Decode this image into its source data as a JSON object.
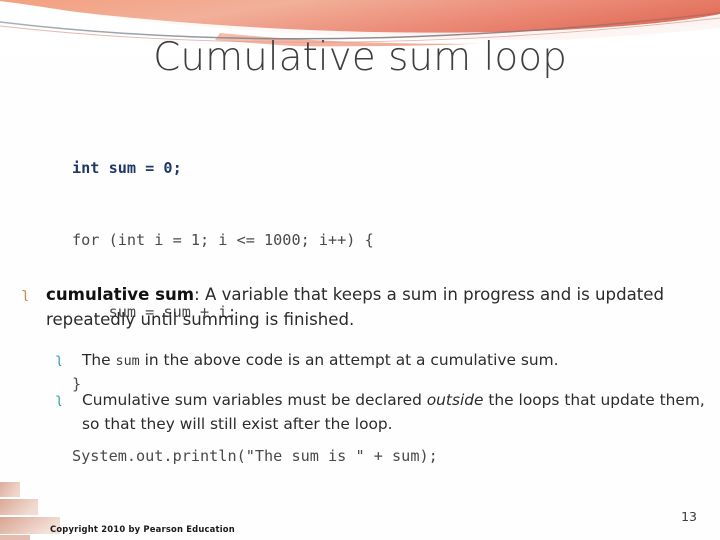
{
  "slide": {
    "title": "Cumulative sum loop",
    "page_number": "13",
    "copyright": "Copyright 2010 by Pearson Education",
    "accent_colors": {
      "swoosh_top": "#f09a7e",
      "swoosh_bottom": "#e8806a",
      "swoosh_light": "#f7b9a4",
      "corner_block": "#e2b4a4",
      "code_keyword": "#1f3864",
      "code_body": "#4a4a4a",
      "bullet_level1": "#c8884a",
      "bullet_level2": "#2b9aa5",
      "title_text": "#3f3f3f",
      "body_text": "#2b2b2b"
    }
  },
  "code": {
    "language": "java",
    "lines": [
      {
        "text": "int sum = 0;",
        "style": "keyword"
      },
      {
        "text": "for (int i = 1; i <= 1000; i++) {",
        "style": "plain"
      },
      {
        "text": "    sum = sum + i;",
        "style": "plain"
      },
      {
        "text": "}",
        "style": "plain"
      },
      {
        "text": "System.out.println(\"The sum is \" + sum);",
        "style": "plain"
      }
    ]
  },
  "bullets": {
    "bullet_glyph_level1": "ʅ",
    "bullet_glyph_level2": "ʅ",
    "level1": {
      "term": "cumulative sum",
      "rest": ": A variable that keeps a sum in progress and is updated repeatedly until summing is finished."
    },
    "level2": [
      {
        "before": "The ",
        "code": "sum",
        "after": " in the above code is an attempt at a cumulative sum.",
        "italic": "",
        "tail": ""
      },
      {
        "before": "Cumulative sum variables must be declared ",
        "code": "",
        "italic": "outside",
        "after": " the loops that update them, so that they will still exist after the loop.",
        "tail": ""
      }
    ]
  }
}
